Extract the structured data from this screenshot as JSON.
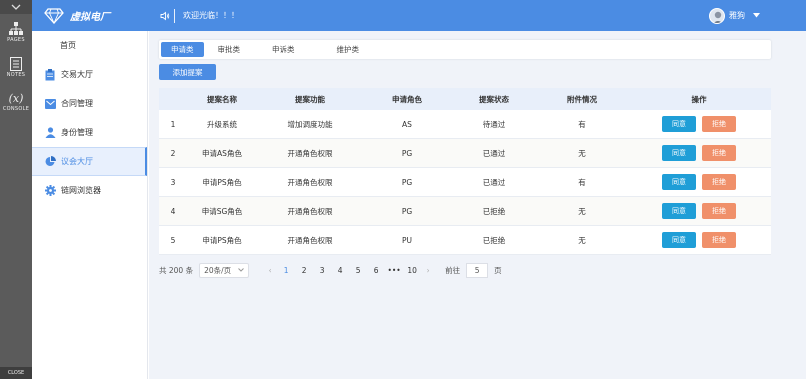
{
  "rail": {
    "pages_label": "PAGES",
    "notes_label": "NOTES",
    "console_symbol": "(x)",
    "console_label": "CONSOLE",
    "close_label": "CLOSE"
  },
  "header": {
    "brand": "虚拟电厂",
    "welcome": "欢迎光临！！！",
    "user_name": "雅狗",
    "accent_color": "#4b8ce3"
  },
  "sidebar": {
    "items": [
      {
        "label": "首页",
        "icon": "none"
      },
      {
        "label": "交易大厅",
        "icon": "clipboard-icon"
      },
      {
        "label": "合同管理",
        "icon": "envelope-icon"
      },
      {
        "label": "身份管理",
        "icon": "person-icon"
      },
      {
        "label": "议会大厅",
        "icon": "pie-chart-icon",
        "active": true
      },
      {
        "label": "链网浏览器",
        "icon": "gear-icon"
      }
    ]
  },
  "tabs": [
    "申请类",
    "审批类",
    "申诉类",
    "维护类"
  ],
  "add_button": "添加提案",
  "table": {
    "headers": [
      "",
      "提案名称",
      "提案功能",
      "申请角色",
      "提案状态",
      "附件情况",
      "操作"
    ],
    "rows": [
      {
        "no": "1",
        "name": "升级系统",
        "func": "增加调度功能",
        "role": "AS",
        "status": "待通过",
        "attach": "有"
      },
      {
        "no": "2",
        "name": "申请AS角色",
        "func": "开通角色权限",
        "role": "PG",
        "status": "已通过",
        "attach": "无"
      },
      {
        "no": "3",
        "name": "申请PS角色",
        "func": "开通角色权限",
        "role": "PG",
        "status": "已通过",
        "attach": "有"
      },
      {
        "no": "4",
        "name": "申请SG角色",
        "func": "开通角色权限",
        "role": "PG",
        "status": "已拒绝",
        "attach": "无"
      },
      {
        "no": "5",
        "name": "申请PS角色",
        "func": "开通角色权限",
        "role": "PU",
        "status": "已拒绝",
        "attach": "无"
      }
    ],
    "agree_label": "同意",
    "reject_label": "拒绝"
  },
  "pager": {
    "total": "共 200 条",
    "page_size": "20条/页",
    "pages": [
      "1",
      "2",
      "3",
      "4",
      "5",
      "6",
      "•••",
      "10"
    ],
    "current": "1",
    "goto_label": "前往",
    "goto_value": "5",
    "page_suffix": "页"
  }
}
